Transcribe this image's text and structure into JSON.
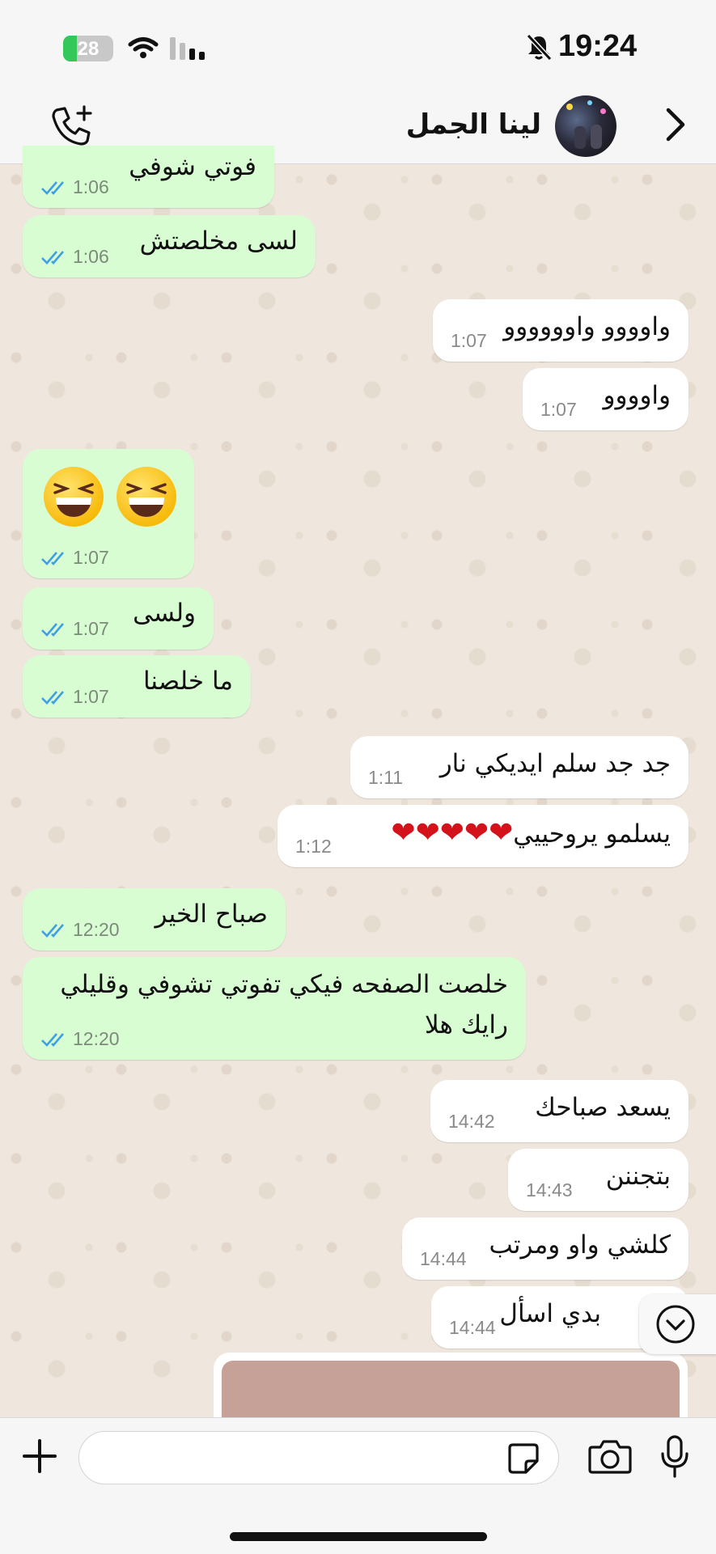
{
  "status": {
    "battery": "28",
    "battery_level": 0.28,
    "time": "19:24"
  },
  "header": {
    "contact_name": "لينا الجمل"
  },
  "messages": [
    {
      "dir": "in",
      "text": "فوتي شوفي",
      "time": "1:06",
      "ticks": true
    },
    {
      "dir": "in",
      "text": "لسى مخلصتش",
      "time": "1:06",
      "ticks": true
    },
    {
      "dir": "out",
      "text": "واوووو واوووووو",
      "time": "1:07"
    },
    {
      "dir": "out",
      "text": "واوووو",
      "time": "1:07"
    },
    {
      "dir": "in",
      "text": "😆😆",
      "time": "1:07",
      "ticks": true
    },
    {
      "dir": "in",
      "text": "ولسى",
      "time": "1:07",
      "ticks": true
    },
    {
      "dir": "in",
      "text": "ما خلصنا",
      "time": "1:07",
      "ticks": true
    },
    {
      "dir": "out",
      "text": "جد جد سلم ايديكي نار",
      "time": "1:11"
    },
    {
      "dir": "out",
      "text": "يسلمو يروحييي",
      "hearts": "❤❤❤❤❤",
      "time": "1:12"
    },
    {
      "dir": "in",
      "text": "صباح الخير",
      "time": "12:20",
      "ticks": true
    },
    {
      "dir": "in",
      "text": "خلصت الصفحه فيكي تفوتي تشوفي وقليلي",
      "text2": "رايك هلا",
      "time": "12:20",
      "ticks": true
    },
    {
      "dir": "out",
      "text": "يسعد صباحك",
      "time": "14:42"
    },
    {
      "dir": "out",
      "text": "بتجننن",
      "time": "14:43"
    },
    {
      "dir": "out",
      "text": "كلشي واو ومرتب",
      "time": "14:44"
    },
    {
      "dir": "out",
      "text": "بدي اسأل",
      "time": "14:44"
    }
  ],
  "colors": {
    "incoming": "#d9fdd3",
    "outgoing": "#ffffff",
    "read_ticks": "#3d9fe6",
    "wallpaper": "#efe7dd"
  },
  "icons": [
    "call-add-icon",
    "back-chevron-icon",
    "plus-icon",
    "sticker-icon",
    "camera-icon",
    "mic-icon",
    "chevron-down-icon",
    "wifi-icon",
    "signal-icon",
    "mute-icon"
  ]
}
